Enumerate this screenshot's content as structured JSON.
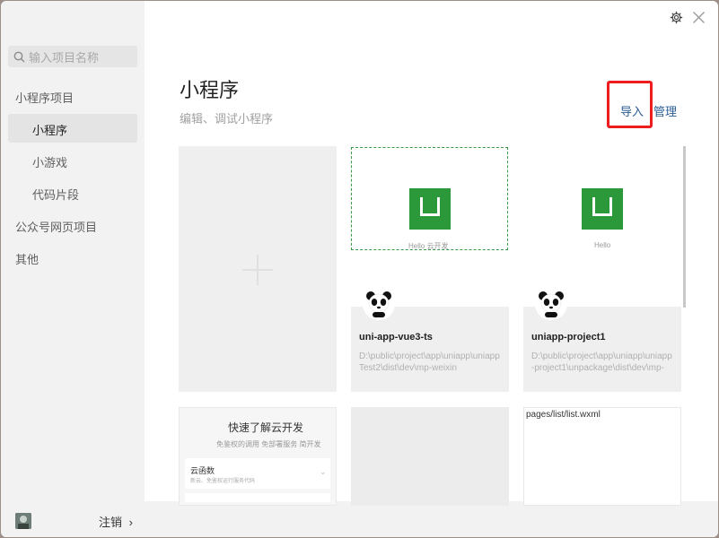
{
  "sidebar": {
    "search_placeholder": "输入项目名称",
    "section_miniprogram": "小程序项目",
    "items": [
      {
        "label": "小程序"
      },
      {
        "label": "小游戏"
      },
      {
        "label": "代码片段"
      }
    ],
    "section_official": "公众号网页项目",
    "section_other": "其他"
  },
  "footer": {
    "logout_label": "注销",
    "logout_arrow": "›"
  },
  "header": {
    "title": "小程序",
    "subtitle": "编辑、调试小程序",
    "import_label": "导入",
    "manage_label": "管理"
  },
  "projects": [
    {
      "name": "uni-app-vue3-ts",
      "path": "D:\\public\\project\\app\\uniapp\\uniappTest2\\dist\\dev\\mp-weixin",
      "thumb_caption": "Hello 云开发"
    },
    {
      "name": "uniapp-project1",
      "path": "D:\\public\\project\\app\\uniapp\\uniapp-project1\\unpackage\\dist\\dev\\mp-",
      "thumb_caption": "Hello"
    }
  ],
  "templates": {
    "cloud_title": "快速了解云开发",
    "cloud_desc": "免鉴权的调用 免部署服务 简开发",
    "cloud_fn_title": "云函数",
    "cloud_fn_desc": "新云、免鉴权运行服务代码",
    "wxml_path": "pages/list/list.wxml"
  },
  "colors": {
    "accent_link": "#2b5d94",
    "highlight_box": "#ee1c1c",
    "uni_green": "#2b9939"
  },
  "icons": {
    "search": "search-icon",
    "settings": "gear-icon",
    "close": "close-icon",
    "add": "plus-icon"
  }
}
